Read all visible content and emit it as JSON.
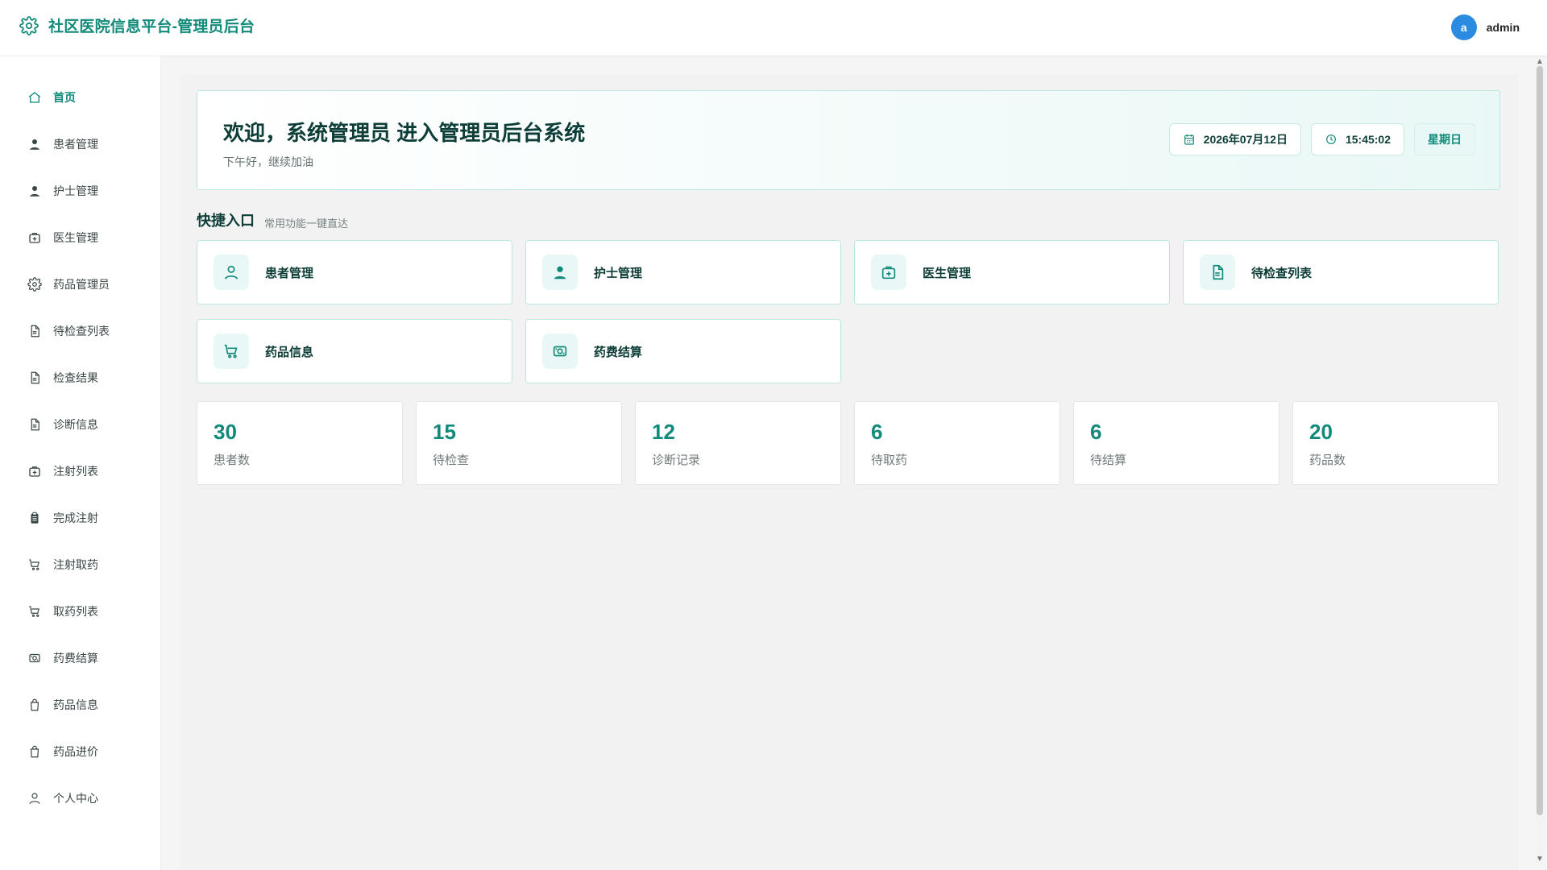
{
  "header": {
    "title": "社区医院信息平台-管理员后台",
    "user": {
      "avatar_letter": "a",
      "name": "admin"
    }
  },
  "sidebar": {
    "items": [
      {
        "label": "首页",
        "icon": "home-icon",
        "active": true
      },
      {
        "label": "患者管理",
        "icon": "user-icon"
      },
      {
        "label": "护士管理",
        "icon": "user-icon"
      },
      {
        "label": "医生管理",
        "icon": "medkit-icon"
      },
      {
        "label": "药品管理员",
        "icon": "gear-icon"
      },
      {
        "label": "待检查列表",
        "icon": "document-icon"
      },
      {
        "label": "检查结果",
        "icon": "document-icon"
      },
      {
        "label": "诊断信息",
        "icon": "document-icon"
      },
      {
        "label": "注射列表",
        "icon": "medkit-icon"
      },
      {
        "label": "完成注射",
        "icon": "clipboard-icon"
      },
      {
        "label": "注射取药",
        "icon": "cart-icon"
      },
      {
        "label": "取药列表",
        "icon": "cart-icon"
      },
      {
        "label": "药费结算",
        "icon": "money-icon"
      },
      {
        "label": "药品信息",
        "icon": "bag-icon"
      },
      {
        "label": "药品进价",
        "icon": "bag-icon"
      },
      {
        "label": "个人中心",
        "icon": "user-outline-icon"
      }
    ]
  },
  "welcome": {
    "title": "欢迎，系统管理员 进入管理员后台系统",
    "subtitle": "下午好，继续加油",
    "date": "2026年07月12日",
    "time": "15:45:02",
    "weekday": "星期日"
  },
  "quick": {
    "title": "快捷入口",
    "subtitle": "常用功能一键直达",
    "cards": [
      {
        "label": "患者管理",
        "icon": "user-outline-icon"
      },
      {
        "label": "护士管理",
        "icon": "user-icon"
      },
      {
        "label": "医生管理",
        "icon": "medkit-icon"
      },
      {
        "label": "待检查列表",
        "icon": "document-icon"
      },
      {
        "label": "药品信息",
        "icon": "cart-icon"
      },
      {
        "label": "药费结算",
        "icon": "money-icon"
      }
    ]
  },
  "stats": [
    {
      "value": "30",
      "label": "患者数"
    },
    {
      "value": "15",
      "label": "待检查"
    },
    {
      "value": "12",
      "label": "诊断记录"
    },
    {
      "value": "6",
      "label": "待取药"
    },
    {
      "value": "6",
      "label": "待结算"
    },
    {
      "value": "20",
      "label": "药品数"
    }
  ],
  "colors": {
    "accent": "#128a7a",
    "avatar": "#2b8be0"
  }
}
